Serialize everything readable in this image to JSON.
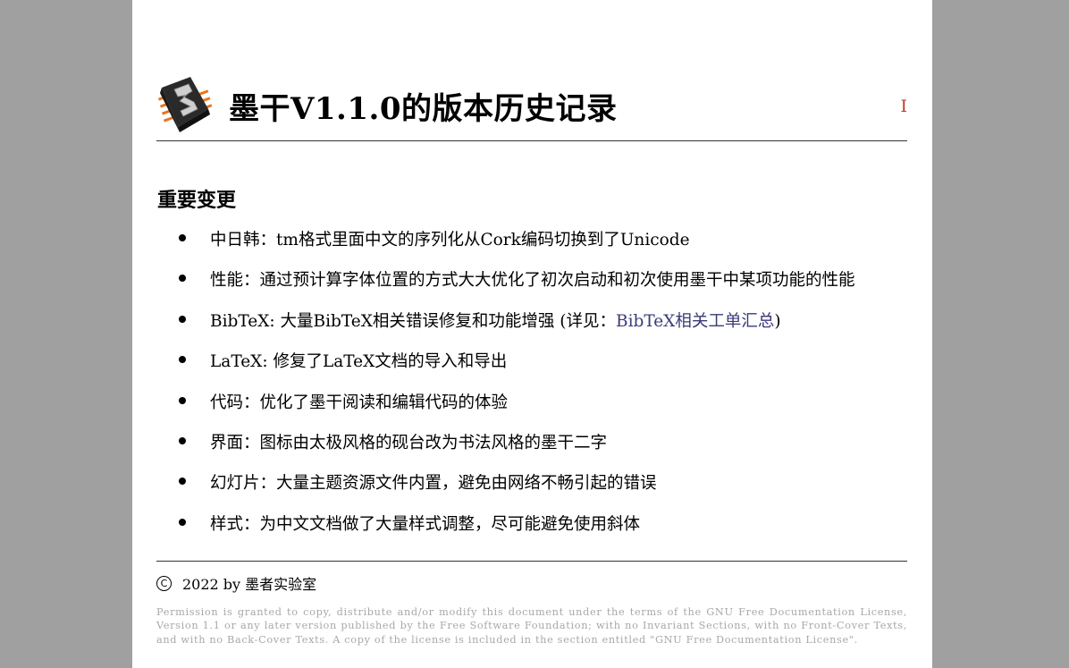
{
  "header": {
    "logo_icon": "mogan-chip-logo-icon",
    "title": "墨干V1.1.0的版本历史记录",
    "page_number": "I"
  },
  "section": {
    "title": "重要变更",
    "items": [
      {
        "text": "中日韩：tm格式里面中文的序列化从Cork编码切换到了Unicode"
      },
      {
        "text": "性能：通过预计算字体位置的方式大大优化了初次启动和初次使用墨干中某项功能的性能"
      },
      {
        "text": "BibTeX: 大量BibTeX相关错误修复和功能增强 (详见：",
        "link": "BibTeX相关工单汇总",
        "suffix": ")"
      },
      {
        "text": "LaTeX: 修复了LaTeX文档的导入和导出"
      },
      {
        "text": "代码：优化了墨干阅读和编辑代码的体验"
      },
      {
        "text": "界面：图标由太极风格的砚台改为书法风格的墨干二字"
      },
      {
        "text": "幻灯片：大量主题资源文件内置，避免由网络不畅引起的错误"
      },
      {
        "text": "样式：为中文文档做了大量样式调整，尽可能避免使用斜体"
      }
    ]
  },
  "footer": {
    "copyright_symbol": "C",
    "copyright_text": "2022 by 墨者实验室",
    "license_text": "Permission is granted to copy, distribute and/or modify this document under the terms of the GNU Free Documentation License, Version 1.1 or any later version published by the Free Software Foundation; with no Invariant Sections, with no Front-Cover Texts, and with no Back-Cover Texts. A copy of the license is included in the section entitled \"GNU Free Documentation License\"."
  },
  "colors": {
    "background": "#a0a0a0",
    "page": "#ffffff",
    "link": "#3a3a7a",
    "page_number": "#c0392b",
    "license_text": "#a8a8a8"
  }
}
